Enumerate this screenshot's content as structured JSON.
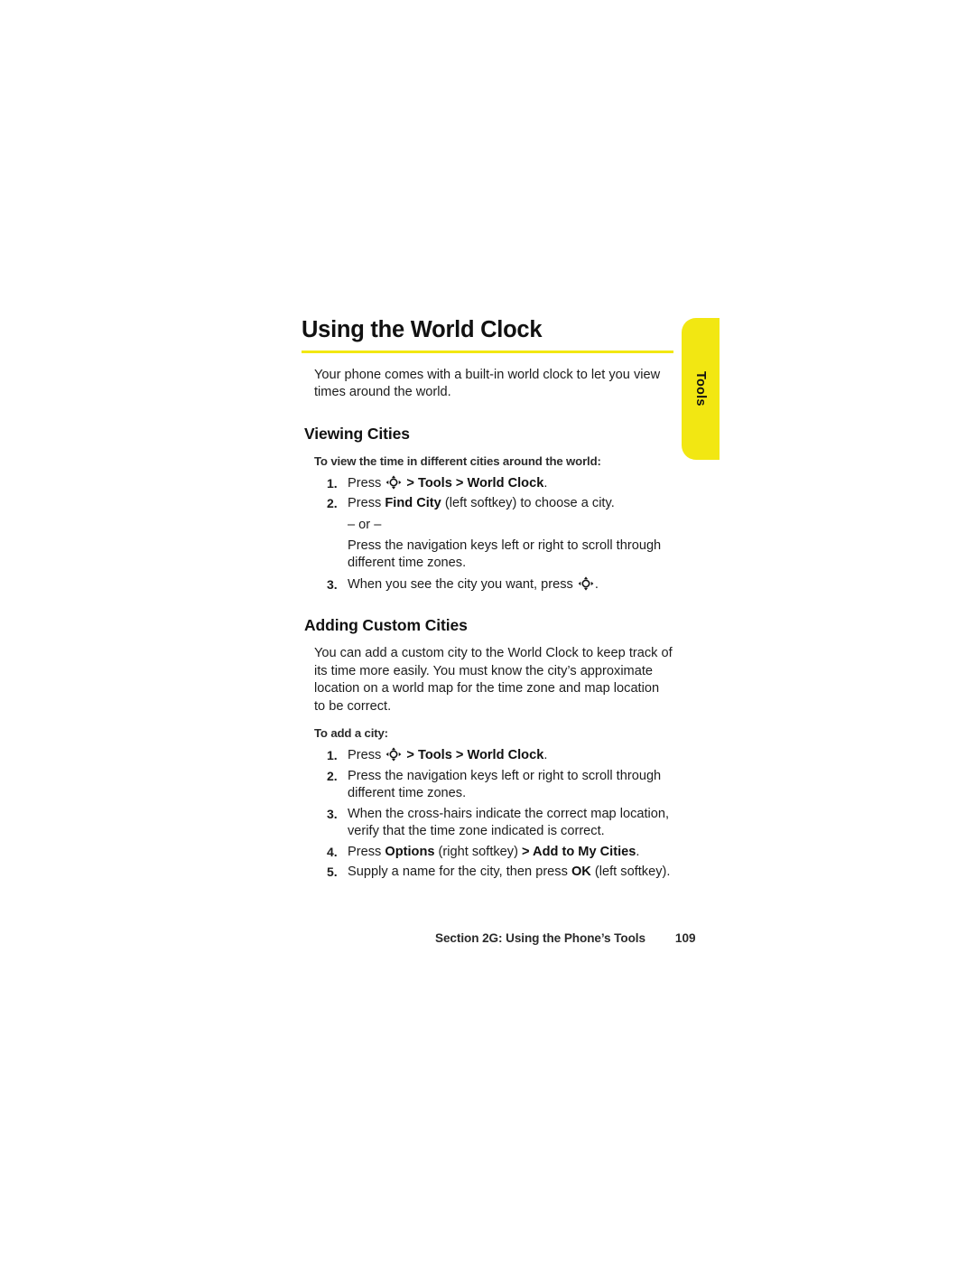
{
  "document": {
    "page_number": "109",
    "accent_color": "#F2E712",
    "background_color": "#FFFFFF"
  },
  "side_tab": {
    "label": "Tools",
    "color": "#F2E712"
  },
  "title": "Using the World Clock",
  "intro": "Your phone comes with a built-in world clock to let you view times around the world.",
  "sections": [
    {
      "heading": "Viewing Cities",
      "lead_in": "To view the time in different cities around the world:",
      "steps": [
        {
          "num": "1.",
          "parts": [
            {
              "type": "text",
              "text": "Press "
            },
            {
              "type": "icon",
              "name": "navigation-key-icon"
            },
            {
              "type": "bold",
              "text": " > Tools > World Clock"
            },
            {
              "type": "text",
              "text": "."
            }
          ]
        },
        {
          "num": "2.",
          "parts": [
            {
              "type": "text",
              "text": "Press "
            },
            {
              "type": "bold",
              "text": "Find City"
            },
            {
              "type": "text",
              "text": " (left softkey) to choose a city."
            }
          ],
          "or_label": "– or –",
          "alt_text": "Press the navigation keys left or right to scroll through different time zones."
        },
        {
          "num": "3.",
          "parts": [
            {
              "type": "text",
              "text": "When you see the city you want, press "
            },
            {
              "type": "icon",
              "name": "navigation-key-icon"
            },
            {
              "type": "text",
              "text": "."
            }
          ]
        }
      ]
    },
    {
      "heading": "Adding Custom Cities",
      "body": "You can add a custom city to the World Clock to keep track of its time more easily. You must know the city’s approximate location on a world map for the time zone and map location to be correct.",
      "lead_in": "To add a city:",
      "steps": [
        {
          "num": "1.",
          "parts": [
            {
              "type": "text",
              "text": "Press "
            },
            {
              "type": "icon",
              "name": "navigation-key-icon"
            },
            {
              "type": "bold",
              "text": " > Tools > World Clock"
            },
            {
              "type": "text",
              "text": "."
            }
          ]
        },
        {
          "num": "2.",
          "parts": [
            {
              "type": "text",
              "text": "Press the navigation keys left or right to scroll through different time zones."
            }
          ]
        },
        {
          "num": "3.",
          "parts": [
            {
              "type": "text",
              "text": "When the cross-hairs indicate the correct map location, verify that the time zone indicated is correct."
            }
          ]
        },
        {
          "num": "4.",
          "parts": [
            {
              "type": "text",
              "text": "Press "
            },
            {
              "type": "bold",
              "text": "Options"
            },
            {
              "type": "text",
              "text": " (right softkey) "
            },
            {
              "type": "bold",
              "text": "> Add to My Cities"
            },
            {
              "type": "text",
              "text": "."
            }
          ]
        },
        {
          "num": "5.",
          "parts": [
            {
              "type": "text",
              "text": "Supply a name for the city, then press "
            },
            {
              "type": "bold",
              "text": "OK"
            },
            {
              "type": "text",
              "text": " (left softkey)."
            }
          ]
        }
      ]
    }
  ],
  "footer": {
    "section_text": "Section 2G: Using the Phone’s Tools",
    "page_number": "109"
  }
}
